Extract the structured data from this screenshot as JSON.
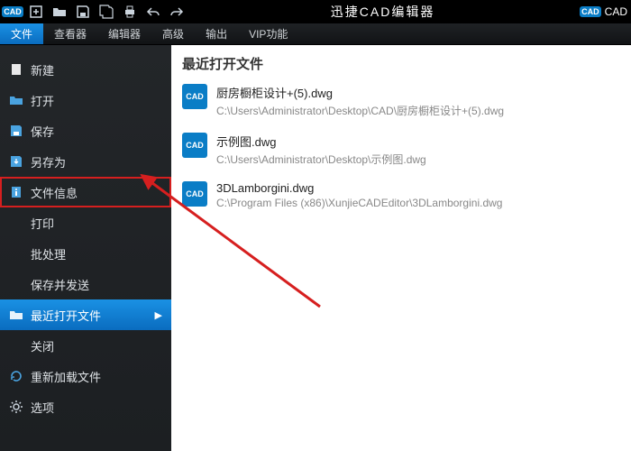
{
  "app": {
    "title": "迅捷CAD编辑器",
    "brand_short": "CAD",
    "right_label": "CAD"
  },
  "menubar": [
    "文件",
    "查看器",
    "编辑器",
    "高级",
    "输出",
    "VIP功能"
  ],
  "sidebar": {
    "items": [
      {
        "label": "新建",
        "icon": "new"
      },
      {
        "label": "打开",
        "icon": "open"
      },
      {
        "label": "保存",
        "icon": "save"
      },
      {
        "label": "另存为",
        "icon": "saveas"
      },
      {
        "label": "文件信息",
        "icon": "info",
        "highlight": true
      },
      {
        "label": "打印"
      },
      {
        "label": "批处理"
      },
      {
        "label": "保存并发送"
      },
      {
        "label": "最近打开文件",
        "icon": "history",
        "active": true
      },
      {
        "label": "关闭"
      },
      {
        "label": "重新加载文件",
        "icon": "reload"
      },
      {
        "label": "选项",
        "icon": "gear"
      }
    ]
  },
  "main": {
    "heading": "最近打开文件",
    "files": [
      {
        "name": "厨房橱柜设计+(5).dwg",
        "path": "C:\\Users\\Administrator\\Desktop\\CAD\\厨房橱柜设计+(5).dwg"
      },
      {
        "name": "示例图.dwg",
        "path": "C:\\Users\\Administrator\\Desktop\\示例图.dwg"
      },
      {
        "name": "3DLamborgini.dwg",
        "path": "C:\\Program Files (x86)\\XunjieCADEditor\\3DLamborgini.dwg"
      }
    ]
  },
  "colors": {
    "accent": "#0a7dc6",
    "highlight": "#d61f1f"
  }
}
